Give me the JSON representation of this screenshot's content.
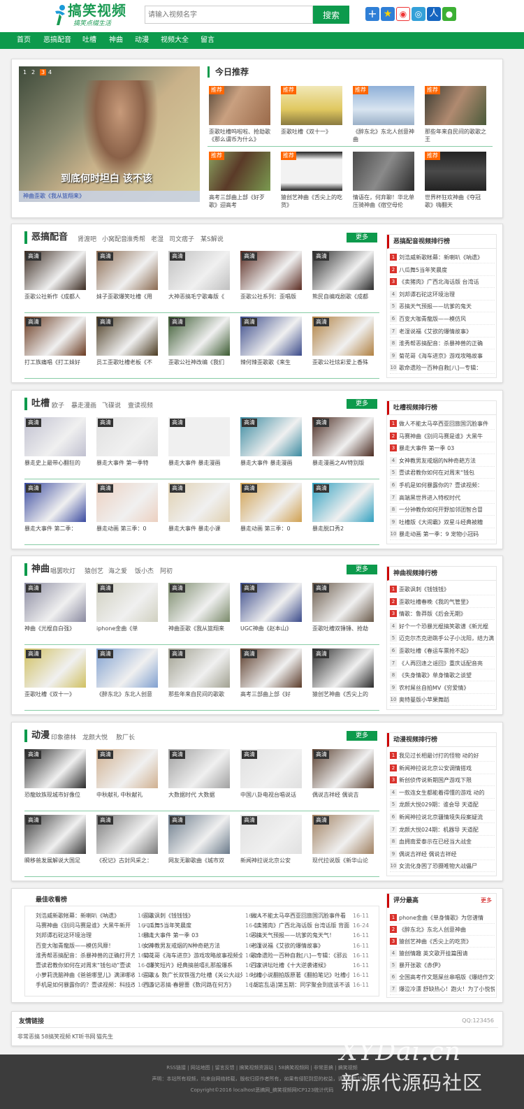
{
  "header": {
    "logo_title": "搞笑视频",
    "logo_slogan": "搞笑点缀生活",
    "search_placeholder": "请输入视频名字",
    "search_button": "搜索",
    "share_icons": [
      "qq-space-icon",
      "favorite-icon",
      "weibo-icon",
      "tencent-weibo-icon",
      "renren-icon",
      "wechat-icon"
    ]
  },
  "nav": [
    "首页",
    "恶搞配音",
    "吐槽",
    "神曲",
    "动漫",
    "视频大全",
    "留言"
  ],
  "banner": {
    "dots": [
      "1",
      "2",
      "3",
      "4"
    ],
    "overlay_text": "到底何时坦白 该不该",
    "caption": "神曲歪歌《我从篮翔来》"
  },
  "today": {
    "title": "今日推荐",
    "badge": "推荐",
    "items": [
      "歪歌吐槽呜啦啦、抢劫歌《那么谓币为什么》",
      "歪歌吐槽《双十一》",
      "《醉东北》东北人创意神曲",
      "那些年来自民间的歌歌之王",
      "高考三部曲上部《好歹歌》迎高考",
      "猿创艺神曲《舌尖上的吃货》",
      "情语在，何弃聊！华北单压骑神曲《宿空母伦",
      "世界杯狂欢神曲《夺冠歌》嗨翻天"
    ]
  },
  "badge_hd": "高清",
  "more_label": "更多",
  "sections": [
    {
      "title": "恶搞配音",
      "links": [
        "肾渡吧",
        "小窝配音",
        "淮秀帮",
        "老湿",
        "司文痞子",
        "某S解说"
      ],
      "items": [
        "歪歌公社新作《成都人",
        "妹子歪歌爆笑吐槽《用",
        "大神恶搞毛宁歌毒版《",
        "歪歌公社系列：歪唱版",
        "熊民自编戏剧歌《成都",
        "打工族痛唱《打工妹好",
        "员工歪歌吐槽老板《不",
        "歪歌公社神改编《我们",
        "辣何辣歪歌歌《来生",
        "歪歌公社炫彩爱上香殊"
      ],
      "rank_title": "恶搞配音视频排行榜",
      "rank": [
        "刘浩威新歌帐幕：新喇叭《呐遗》",
        "八瓜舞5当年笑晨度",
        "《卖猪肉》广西北海话版 台湾话",
        "刘邦谭石砣这环境治理",
        "恶搞天气预报——坑爹的鬼天",
        "百变大咖青龍版——模仿风",
        "老湿说福《艾欲的爆情故事》",
        "淮秀帮恶搞配音：杀暴神兽的正确",
        "菊花哥《海车进京》游戏攻略故事",
        "歌命遗险一百种自救[八]—专辑："
      ]
    },
    {
      "title": "吐槽",
      "links": [
        "欧子",
        "暴走漫画",
        "飞碟说",
        "壹读视频"
      ],
      "items": [
        "暴走史上最带心翻狂的",
        "暴走大事件 第一季特",
        "暴走大事件 暴走漫画",
        "暴走大事件 暴走漫画",
        "暴走漫画之AV特别版",
        "暴走大事件 第二季：",
        "暴走动画 第三季：0",
        "暴走大事件 暴走小课",
        "暴走动画 第三季：0",
        "暴走脱口秀2"
      ],
      "rank_title": "吐槽视频排行榜",
      "rank": [
        "做人不能太马卒西亚回旅国沉脸事件",
        "马赛神曲《别问马赛是谁》大黑牛",
        "暴走大事件 第一季 03",
        "女神教男友戒烟的N种奇葩方法",
        "壹读君教你如何在对周末“钱包",
        "手机是如何暴露你的？壹读视频：",
        "高端黑世界进入特权时代",
        "一分钟教你如何开野加邻团智合冒",
        "吐槽版《大闹霸》双星斗经典被糟",
        "暴走动画 第一季：9 宠物小冠码"
      ]
    },
    {
      "title": "神曲",
      "links": [
        "唱罢吹灯",
        "猿创艺",
        "海之爱",
        "饭小杰",
        "阿初"
      ],
      "items": [
        "神曲《光棍自白强》",
        "iphone金曲《单",
        "神曲歪歌《我从篮翔来",
        "UGC神曲《赵本山》",
        "歪歌吐槽双锤锤、抢劫",
        "歪歌吐槽《双十一》",
        "《醉东北》东北人创意",
        "那些年来自民间的歌歌",
        "高考三部曲上部《好",
        "猿创艺神曲《舌尖上的"
      ],
      "rank_title": "神曲视频排行榜",
      "rank": [
        "歪歌讽刺《钱钱钱》",
        "歪歌吐槽春晚《我的气管里》",
        "情歌：鲁莽版《后会无期》",
        "好个一个恐暴光棍搞笑歌谱《新光棍",
        "迈克尔杰克逊跳手公子小沈阳，结力满",
        "歪歌吐槽《春运车票抢不起》",
        "《人再回逢之谣回》重庆话配音亮",
        "《失身情歌》单身情歌之谈望",
        "农村屌丝自拍MV《穷爱情》",
        "奥特曼版小苹果舞蹈"
      ]
    },
    {
      "title": "动漫",
      "links": [
        "印象德林",
        "龙颜大悦",
        "敖厂长"
      ],
      "items": [
        "恐龍蚊族现城市好像位",
        "中秋献礼 中秋献礼",
        "大数据时代 大数据",
        "中国八卦电视台唱说话",
        "偶说吉祥经 偶说吉",
        "瞬移爸发展解说大国足",
        "《祝记》古封风采之：",
        "网友无聊歌曲《城市双",
        "新闻神拉说北京公安",
        "现代拉说版《新华山论"
      ],
      "rank_title": "动漫视频排行榜",
      "rank": [
        "我见过长相最讨打的怪物 动的好",
        "新闻神拉说北京公安调情搭戏",
        "新创侦传说新期国产游戏下限",
        "一款连女生都能着得懂的游戏 动的",
        "龙颜大悦029期：谁会导 天道配",
        "新闻神拉说北京疆情境失段案疑流",
        "龙颜大悦024期：机器导 天道配",
        "血拥南爱泰示在已经当大战金",
        "偶说吉祥经 偶说吉祥经",
        "女流化身困了恐摄唯物大战儡尸"
      ]
    }
  ],
  "best": {
    "title": "最佳收看榜",
    "col1": [
      [
        "刘浩威新歌帐幕：新喇叭《呐遗》",
        "16-11"
      ],
      [
        "马赛神曲《别问马赛是谁》大黑牛新开",
        "16-11"
      ],
      [
        "刘邦谭石砣这环境治理",
        "16-11"
      ],
      [
        "百变大咖青龍版——模仿风靡！",
        "16-11"
      ],
      [
        "淮秀帮恶搞配音：杀暴神兽的正确打开方",
        "16-11"
      ],
      [
        "壹读君教你如何在对周末“钱包动”壹读",
        "16-11"
      ],
      [
        "小萝莉洗脑神曲《爸爸哪里儿》满涕哪收",
        "16-11"
      ],
      [
        "手机是如何暴露你的？壹读视频：科技改",
        "16-11"
      ]
    ],
    "col2": [
      [
        "歪歌讽刺《钱钱钱》",
        "16-24"
      ],
      [
        "八瓜舞5当年笑晨度",
        "16-11"
      ],
      [
        "暴走大事件 第一季 03",
        "16-11"
      ],
      [
        "女神教男友戒烟的N种奇葩方法",
        "16-11"
      ],
      [
        "菊花哥《海车进京》游戏攻略故事视频全",
        "16-11"
      ],
      [
        "《爆笑短片》经典搞爸嘻扎那般爆系",
        "16-11"
      ],
      [
        "歪歌＆ 数广长双铁强力吐槽《关公大战外",
        "16-11"
      ],
      [
        "西游记恶搞·春碧蔷《数问路在何方》",
        "16-11"
      ]
    ],
    "col3": [
      [
        "做人不能太马卒西亚回旅国沉脸事件看",
        "16-11"
      ],
      [
        "《卖猪肉》广西北海话版 台湾话版 背面",
        "16-24"
      ],
      [
        "恶搞天气预报——坑爹的鬼天气！",
        "16-11"
      ],
      [
        "老湿说福《艾欲的爆情故事》",
        "16-11"
      ],
      [
        "歌命遗险一百种自救[八]—专辑：《邪云",
        "16-11"
      ],
      [
        "百家讲坛吐槽《十大逆袭诸候》",
        "16-11"
      ],
      [
        "吐槽小说翻拍版原著《翻拍笔记》吐槽小",
        "16-11"
      ],
      [
        "[胡言乱语]第五期：同学聚会到底该不该",
        "16-11"
      ]
    ],
    "top_title": "评分最高",
    "top_more": "更多",
    "top": [
      "phone金曲《单身情歌》为您谱情",
      "《醉东北》东北人创意神曲",
      "猿创艺神曲《舌尖上的吃货》",
      "猿创情趣 英文歌开挂篇围请",
      "暴开张歌《赤伊》",
      "全国高考作文题屎丝串唱版《爆结作文我",
      "爆泣冷漂 舒缺热心！跑火！为了小悦悦"
    ]
  },
  "friends": {
    "title": "友情链接",
    "qq": "QQ:123456",
    "links": [
      "非常恶搞",
      "58搞笑视频",
      "KT听书网",
      "猫先生"
    ]
  },
  "footer": {
    "links": "RSS链接 | 网站地图 | 留言反馈 | 搞笑视频资源站 | 58搞笑视频网 | 非常恶搞 | 搞笑视频",
    "notice": "声明：本站所有视频，均来自网络转载，版权归原作者所有，如果有侵犯到您的权益，请联系本站删除",
    "copyright": "Copyright©2016 localhost恶搞网_搞笑视频网ICP123统计代码",
    "watermark_top": "XYDai.cn",
    "watermark_bottom": "新源代源码社区"
  },
  "colors": {
    "brand": "#0d9a4c",
    "rank_top": "#d9312b",
    "recommend_badge": "#ff6600"
  }
}
